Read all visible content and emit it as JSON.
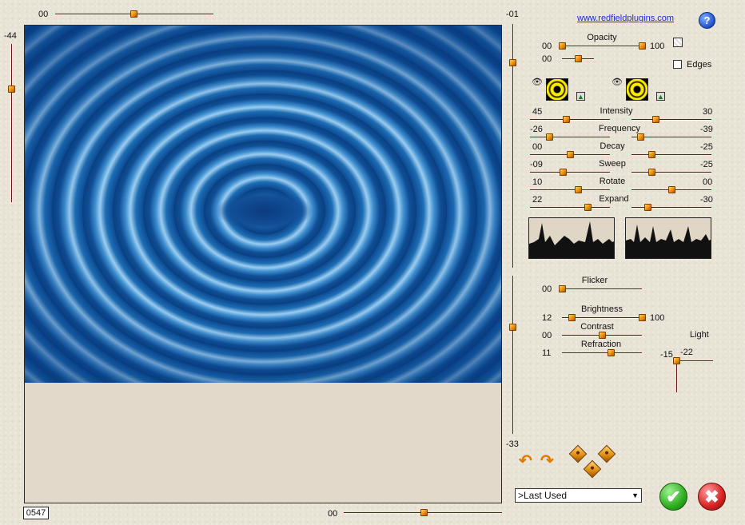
{
  "top_slider": {
    "value_label": "00"
  },
  "left_slider": {
    "value_label": "-44"
  },
  "right_divider_slider": {
    "top_label": "-01",
    "bottom_label": "-33"
  },
  "bottom_slider": {
    "value_label": "00"
  },
  "preview": {
    "frame_counter": "0547"
  },
  "header": {
    "link_text": "www.redfieldplugins.com",
    "help_label": "?"
  },
  "opacity": {
    "label": "Opacity",
    "left_value": "00",
    "right_value": "100",
    "second_value": "00"
  },
  "edges": {
    "label": "Edges"
  },
  "wave_params": [
    {
      "label": "Intensity",
      "left": "45",
      "right": "30"
    },
    {
      "label": "Frequency",
      "left": "-26",
      "right": "-39"
    },
    {
      "label": "Decay",
      "left": "00",
      "right": "-25"
    },
    {
      "label": "Sweep",
      "left": "-09",
      "right": "-25"
    },
    {
      "label": "Rotate",
      "left": "10",
      "right": "00"
    },
    {
      "label": "Expand",
      "left": "22",
      "right": "-30"
    }
  ],
  "lighting": {
    "flicker": {
      "label": "Flicker",
      "value": "00"
    },
    "brightness": {
      "label": "Brightness",
      "left": "12",
      "right": "100"
    },
    "contrast": {
      "label": "Contrast",
      "value": "00"
    },
    "refraction": {
      "label": "Refraction",
      "value": "11"
    },
    "light": {
      "label": "Light",
      "x_value": "-15",
      "y_value": "-22"
    }
  },
  "preset": {
    "selected": ">Last Used"
  },
  "icons": {
    "undo": "undo-arrow-icon",
    "redo": "redo-arrow-icon",
    "dice": "random-dice-icon",
    "ok": "checkmark-icon",
    "cancel": "close-icon"
  },
  "colors": {
    "accent": "#f39a12",
    "slider_track": "#6b1414",
    "ok": "#2fae22",
    "cancel": "#d82222",
    "link": "#1a2bd6"
  }
}
